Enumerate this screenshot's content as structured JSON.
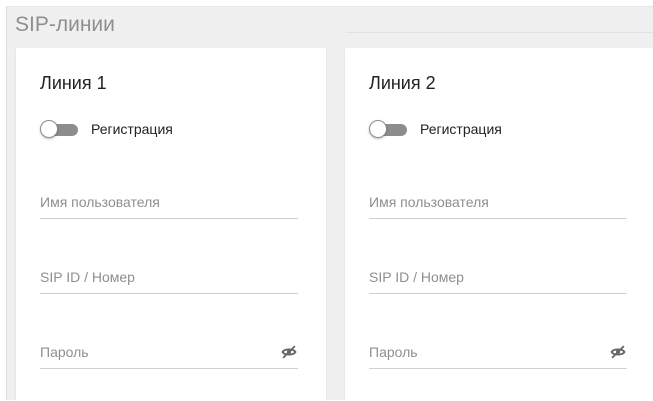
{
  "section": {
    "title": "SIP-линии"
  },
  "lines": [
    {
      "title": "Линия 1",
      "registration_label": "Регистрация",
      "registration_on": false,
      "username_placeholder": "Имя пользователя",
      "username_value": "",
      "sipid_placeholder": "SIP ID / Номер",
      "sipid_value": "",
      "password_placeholder": "Пароль",
      "password_value": "",
      "password_icon": "eye-off-icon"
    },
    {
      "title": "Линия 2",
      "registration_label": "Регистрация",
      "registration_on": false,
      "username_placeholder": "Имя пользователя",
      "username_value": "",
      "sipid_placeholder": "SIP ID / Номер",
      "sipid_value": "",
      "password_placeholder": "Пароль",
      "password_value": "",
      "password_icon": "eye-off-icon"
    }
  ],
  "colors": {
    "background": "#f0f0f0",
    "card": "#ffffff",
    "toggle_off": "#8d8d8d",
    "title_text": "#8f8f8f"
  }
}
